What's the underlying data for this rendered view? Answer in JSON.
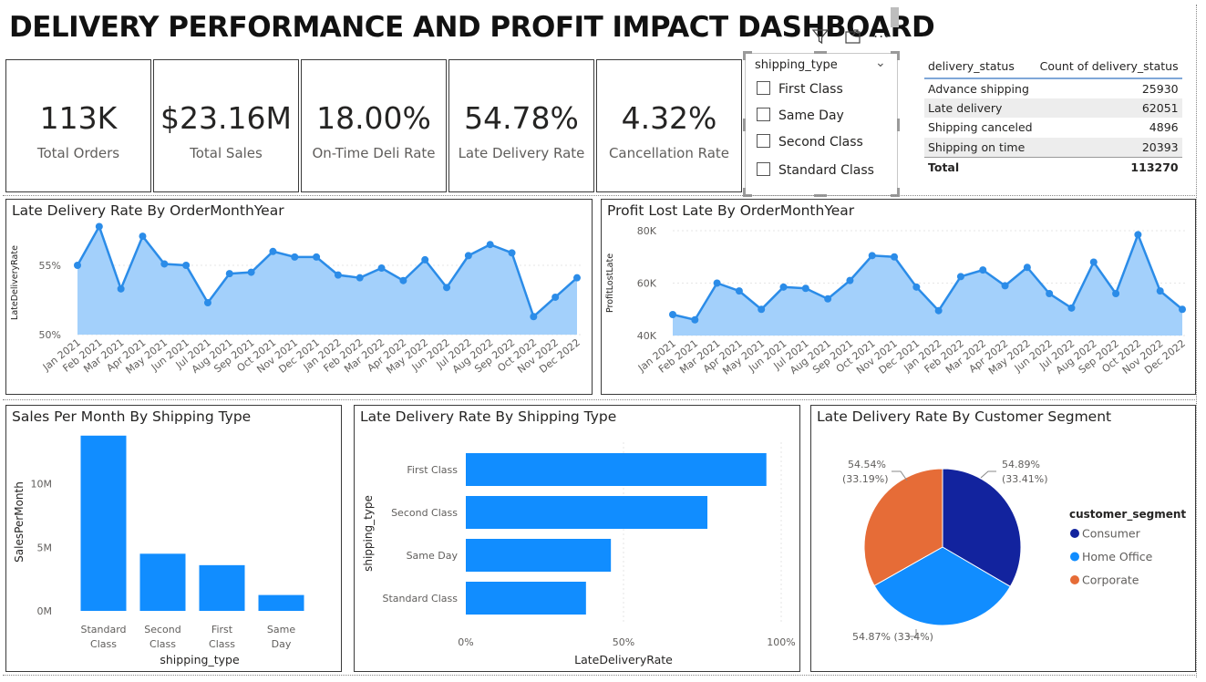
{
  "title": "DELIVERY PERFORMANCE AND PROFIT IMPACT DASHBOARD",
  "kpis": [
    {
      "value": "113K",
      "label": "Total Orders"
    },
    {
      "value": "$23.16M",
      "label": "Total Sales"
    },
    {
      "value": "18.00%",
      "label": "On-Time Deli Rate"
    },
    {
      "value": "54.78%",
      "label": "Late Delivery Rate"
    },
    {
      "value": "4.32%",
      "label": "Cancellation Rate"
    }
  ],
  "slicer": {
    "field": "shipping_type",
    "options": [
      "First Class",
      "Same Day",
      "Second Class",
      "Standard Class"
    ],
    "toolbar_more": "..."
  },
  "status_table": {
    "headers": [
      "delivery_status",
      "Count of delivery_status"
    ],
    "rows": [
      [
        "Advance shipping",
        "25930"
      ],
      [
        "Late delivery",
        "62051"
      ],
      [
        "Shipping canceled",
        "4896"
      ],
      [
        "Shipping on time",
        "20393"
      ]
    ],
    "total": [
      "Total",
      "113270"
    ]
  },
  "colors": {
    "accent": "#118dff",
    "area_fill": "#a3d0fb",
    "line": "#2b8ce8",
    "consumer": "#12239e",
    "home_office": "#118dff",
    "corporate": "#e66c37"
  },
  "chart_data": [
    {
      "id": "late-rate-line",
      "type": "area",
      "title": "Late Delivery Rate By OrderMonthYear",
      "ylabel": "LateDeliveryRate",
      "xlabel": "",
      "yticks": [
        "50%",
        "55%"
      ],
      "ylim": [
        50,
        57.5
      ],
      "x": [
        "Jan 2021",
        "Feb 2021",
        "Mar 2021",
        "Apr 2021",
        "May 2021",
        "Jun 2021",
        "Jul 2021",
        "Aug 2021",
        "Sep 2021",
        "Oct 2021",
        "Nov 2021",
        "Dec 2021",
        "Jan 2022",
        "Feb 2022",
        "Mar 2022",
        "Apr 2022",
        "May 2022",
        "Jun 2022",
        "Jul 2022",
        "Aug 2022",
        "Sep 2022",
        "Oct 2022",
        "Nov 2022",
        "Dec 2022"
      ],
      "values": [
        55.0,
        57.8,
        53.3,
        57.1,
        55.1,
        55.0,
        52.3,
        54.4,
        54.5,
        56.0,
        55.6,
        55.6,
        54.3,
        54.1,
        54.8,
        53.9,
        55.4,
        53.4,
        55.7,
        56.5,
        55.9,
        51.3,
        52.7,
        54.1
      ]
    },
    {
      "id": "profit-lost-line",
      "type": "area",
      "title": "Profit Lost Late By OrderMonthYear",
      "ylabel": "ProfitLostLate",
      "xlabel": "",
      "yticks": [
        "40K",
        "60K",
        "80K"
      ],
      "ylim": [
        40000,
        80000
      ],
      "x": [
        "Jan 2021",
        "Feb 2021",
        "Mar 2021",
        "Apr 2021",
        "May 2021",
        "Jun 2021",
        "Jul 2021",
        "Aug 2021",
        "Sep 2021",
        "Oct 2021",
        "Nov 2021",
        "Dec 2021",
        "Jan 2022",
        "Feb 2022",
        "Mar 2022",
        "Apr 2022",
        "May 2022",
        "Jun 2022",
        "Jul 2022",
        "Aug 2022",
        "Sep 2022",
        "Oct 2022",
        "Nov 2022",
        "Dec 2022"
      ],
      "values": [
        48000,
        46000,
        60000,
        57000,
        50000,
        58500,
        58000,
        54000,
        61000,
        70500,
        70000,
        58500,
        49500,
        62500,
        65000,
        59000,
        66000,
        56000,
        50500,
        68000,
        56000,
        78500,
        57000,
        50000
      ]
    },
    {
      "id": "sales-by-shipping",
      "type": "bar",
      "title": "Sales Per Month By Shipping Type",
      "xlabel": "shipping_type",
      "ylabel": "SalesPerMonth",
      "yticks": [
        "0M",
        "5M",
        "10M"
      ],
      "ylim": [
        0,
        14000000
      ],
      "categories": [
        "Standard Class",
        "Second Class",
        "First Class",
        "Same Day"
      ],
      "values": [
        13800000,
        4500000,
        3600000,
        1250000
      ]
    },
    {
      "id": "late-rate-by-shipping",
      "type": "bar",
      "title": "Late Delivery Rate By Shipping Type",
      "xlabel": "LateDeliveryRate",
      "ylabel": "shipping_type",
      "xticks": [
        "0%",
        "50%",
        "100%"
      ],
      "xlim": [
        0,
        100
      ],
      "categories": [
        "First Class",
        "Second Class",
        "Same Day",
        "Standard Class"
      ],
      "values": [
        95.3,
        76.6,
        46.0,
        38.1
      ]
    },
    {
      "id": "late-rate-by-segment",
      "type": "pie",
      "title": "Late Delivery Rate By Customer Segment",
      "legend_title": "customer_segment",
      "legend_position": "right",
      "categories": [
        "Consumer",
        "Home Office",
        "Corporate"
      ],
      "values": [
        54.89,
        54.87,
        54.54
      ],
      "shares": [
        33.41,
        33.4,
        33.19
      ],
      "labels": [
        "54.89%",
        "(33.41%)",
        "54.87% (33.4%)",
        "54.54%",
        "(33.19%)"
      ]
    }
  ]
}
